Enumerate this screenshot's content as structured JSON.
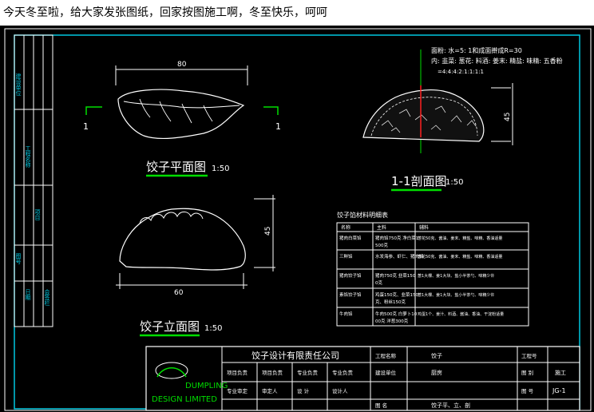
{
  "caption": "今天冬至啦，给大家发张图纸，回家按图施工啊，冬至快乐，呵呵",
  "colors": {
    "background": "#000000",
    "lines": "#ffffff",
    "cyan": "#00c8e0",
    "green": "#00dd00",
    "red": "#ff2020"
  },
  "plan_view": {
    "title": "饺子平面图",
    "scale": "1:50",
    "dim_width": "80",
    "section_mark_left": "1",
    "section_mark_right": "1"
  },
  "section_view": {
    "title": "1-1剖面图",
    "scale": "1:50",
    "dim_height": "45",
    "note_line1": "面粉: 水=5: 1和成面擀成R=30",
    "note_line2": "内: 韭菜: 葱花: 料酒: 姜末: 精盐: 味精: 五香粉",
    "note_line3": "=4:4:4:2:1:1:1:1"
  },
  "elevation_view": {
    "title": "饺子立面图",
    "scale": "1:50",
    "dim_width": "60",
    "dim_height": "45"
  },
  "table": {
    "title": "饺子馅材料明细表",
    "headers": [
      "名称",
      "主料",
      "辅料"
    ],
    "rows": [
      [
        "猪肉白菜馅",
        "猪肉馅750克 净白菜1500克",
        "葱花50克、酱油、姜末、精盐、味精、香油适量"
      ],
      [
        "三鲜馅",
        "水发海参、虾仁、猪肉馅",
        "葱花50克、酱油、姜末、精盐、味精、香油适量"
      ],
      [
        "猪肉饺子馅",
        "猪肉750克 韭菜1500克",
        "葱1大棵、姜1大块、盐小半茶勺、味精少许"
      ],
      [
        "素馅饺子馅",
        "鸡蛋150克、韭菜150克、粉丝150克",
        "葱1大棵、姜1大块、盐小半茶勺、味精少许"
      ],
      [
        "牛肉馅",
        "牛肉500克 白萝卜1000克 洋葱300克",
        "鸡蛋1个、姜汁、料酒、酱油、香油、干淀粉适量"
      ]
    ]
  },
  "title_block": {
    "company": "饺子设计有限责任公司",
    "logo_text1": "DUMPLING",
    "logo_text2": "DESIGN LIMITED",
    "row1": [
      "项目负责",
      "项目负责",
      "专业负责",
      "专业负责"
    ],
    "row2": [
      "专业审定",
      "审定人",
      "设  计",
      "设计人"
    ],
    "project_name_label": "工程名称",
    "project_name_value": "饺子",
    "client_label": "建设单位",
    "client_value": "厨房",
    "drawing_name_label": "图  名",
    "drawing_name_value": "饺子平、立、剖",
    "project_no_label": "工程号",
    "drawing_no_label": "图  别",
    "drawing_no_value": "施工",
    "sheet_label": "图  号",
    "sheet_value": "JG-1"
  },
  "side_strip_rows": [
    "建设单位",
    "工程名称",
    "项目",
    "图号",
    "日期",
    "会签栏"
  ]
}
